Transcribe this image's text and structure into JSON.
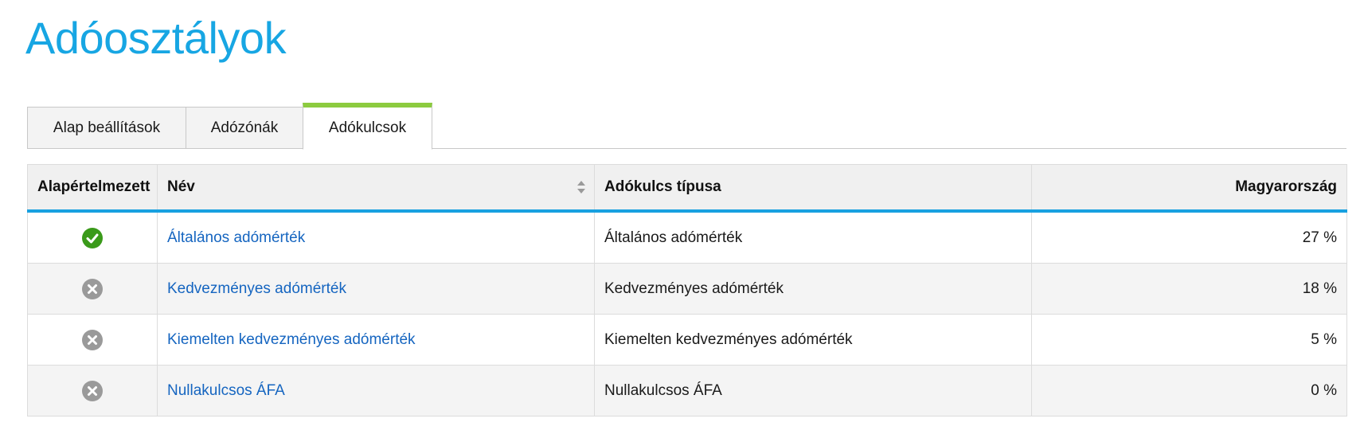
{
  "page": {
    "title": "Adóosztályok"
  },
  "tabs": [
    {
      "label": "Alap beállítások",
      "active": false
    },
    {
      "label": "Adózónák",
      "active": false
    },
    {
      "label": "Adókulcsok",
      "active": true
    }
  ],
  "colors": {
    "title": "#17a6e3",
    "active_tab_accent": "#8ccb3f",
    "header_underline": "#18a0e0",
    "link": "#1565c0",
    "check_green": "#3a9a1a",
    "cross_gray": "#9a9a9a"
  },
  "table": {
    "columns": [
      {
        "label": "Alapértelmezett"
      },
      {
        "label": "Név",
        "sortable": true
      },
      {
        "label": "Adókulcs típusa"
      },
      {
        "label": "Magyarország"
      }
    ],
    "rows": [
      {
        "default_icon": "check-circle-icon",
        "name": "Általános adómérték",
        "type": "Általános adómérték",
        "rate": "27 %"
      },
      {
        "default_icon": "x-circle-icon",
        "name": "Kedvezményes adómérték",
        "type": "Kedvezményes adómérték",
        "rate": "18 %"
      },
      {
        "default_icon": "x-circle-icon",
        "name": "Kiemelten kedvezményes adómérték",
        "type": "Kiemelten kedvezményes adómérték",
        "rate": "5 %"
      },
      {
        "default_icon": "x-circle-icon",
        "name": "Nullakulcsos ÁFA",
        "type": "Nullakulcsos ÁFA",
        "rate": "0 %"
      }
    ]
  }
}
